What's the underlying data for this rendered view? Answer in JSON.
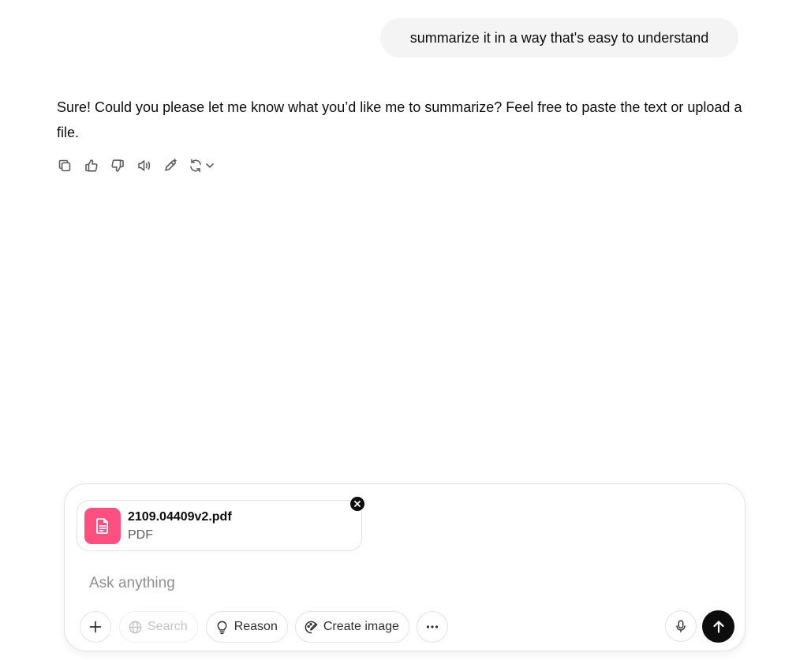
{
  "conversation": {
    "user_message": "summarize it in a way that's easy to understand",
    "assistant_message": "Sure! Could you please let me know what you’d like me to summarize? Feel free to paste the text or upload a file.",
    "message_actions": [
      "copy-icon",
      "thumbs-up-icon",
      "thumbs-down-icon",
      "read-aloud-icon",
      "edit-icon",
      "regenerate-icon"
    ]
  },
  "composer": {
    "attachment": {
      "file_name": "2109.04409v2.pdf",
      "file_type": "PDF",
      "icon": "document-icon",
      "tile_color": "#fd4f80"
    },
    "placeholder": "Ask anything",
    "buttons": {
      "search_label": "Search",
      "reason_label": "Reason",
      "create_image_label": "Create image"
    }
  },
  "colors": {
    "user_bubble_bg": "#f4f4f4",
    "send_button": "#0d0d0d",
    "placeholder_text": "#8f8f8f"
  }
}
